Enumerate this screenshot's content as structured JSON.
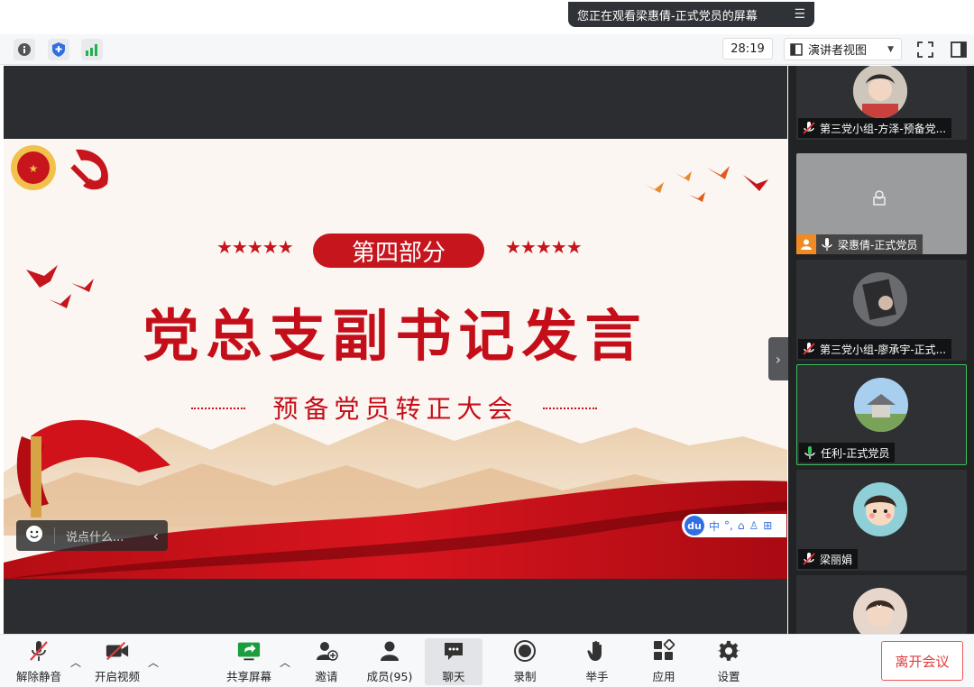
{
  "banner": {
    "text": "您正在观看梁惠倩-正式党员的屏幕",
    "menu_icon": "menu-lines-icon"
  },
  "topbar": {
    "timer": "28:19",
    "view_mode": "演讲者视图"
  },
  "slide": {
    "tag": "第四部分",
    "stars": "★★★★★",
    "title": "党总支副书记发言",
    "subtitle": "预备党员转正大会",
    "colors": {
      "red": "#c40e19",
      "bg": "#fbf6f1"
    }
  },
  "ime": {
    "logo": "du",
    "items": [
      "中",
      "°,",
      "⌂",
      "♙",
      "⊞"
    ]
  },
  "chat": {
    "placeholder": "说点什么..."
  },
  "participants": [
    {
      "name": "第三党小组-方泽-预备党...",
      "muted": true,
      "active": false
    },
    {
      "name": "梁惠倩-正式党员",
      "muted": false,
      "active": false,
      "sharing": true
    },
    {
      "name": "第三党小组-廖承宇-正式...",
      "muted": true,
      "active": false
    },
    {
      "name": "任利-正式党员",
      "muted": false,
      "active": true
    },
    {
      "name": "梁丽娟",
      "muted": true,
      "active": false
    }
  ],
  "toolbar": {
    "unmute": "解除静音",
    "video": "开启视频",
    "share": "共享屏幕",
    "invite": "邀请",
    "members": "成员(95)",
    "chat": "聊天",
    "record": "录制",
    "raise_hand": "举手",
    "apps": "应用",
    "settings": "设置",
    "leave": "离开会议"
  }
}
